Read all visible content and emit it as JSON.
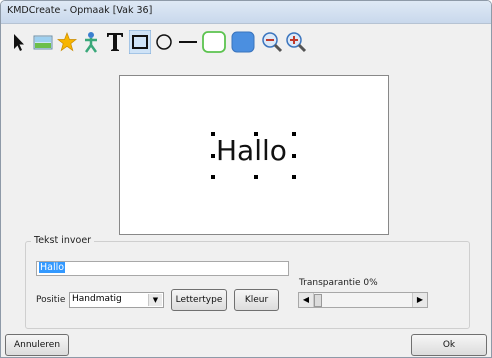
{
  "window": {
    "title": "KMDCreate - Opmaak [Vak 36]"
  },
  "toolbar": {
    "tools": [
      "pointer-tool",
      "image-tool",
      "star-tool",
      "figure-tool",
      "text-tool",
      "rectangle-tool",
      "ellipse-tool",
      "line-tool",
      "rounded-rect-outline-tool",
      "rounded-rect-filled-tool",
      "zoom-out-tool",
      "zoom-in-tool"
    ]
  },
  "canvas": {
    "text": "Hallo"
  },
  "tekst_invoer": {
    "label": "Tekst invoer",
    "value": "Hallo",
    "positie_label": "Positie",
    "positie_value": "Handmatig",
    "lettertype_button": "Lettertype",
    "kleur_button": "Kleur",
    "transparantie_label": "Transparantie 0%",
    "transparantie_value": 0
  },
  "footer": {
    "cancel_label": "Annuleren",
    "ok_label": "Ok"
  },
  "colors": {
    "selection": "#3399ff",
    "accent_green": "#5cc34f",
    "accent_blue": "#4b8fe0"
  }
}
